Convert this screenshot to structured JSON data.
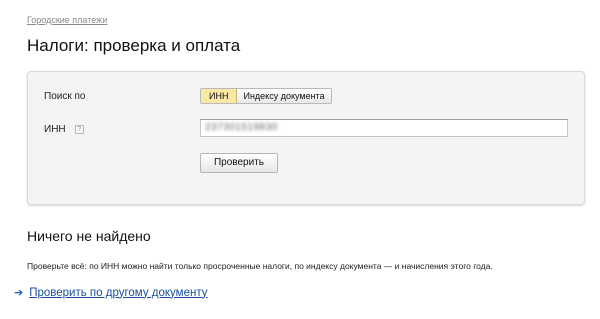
{
  "breadcrumb": "Городские платежи",
  "title": "Налоги: проверка и оплата",
  "form": {
    "search_label": "Поиск по",
    "toggle": [
      "ИНН",
      "Индексу документа"
    ],
    "active_toggle": "ИНН",
    "inn_label": "ИНН",
    "help_glyph": "?",
    "inn_value": "237301519830",
    "submit_label": "Проверить"
  },
  "result": {
    "title": "Ничего не найдено",
    "text": "Проверьте всё: по ИНН можно найти только просроченные налоги, по индексу документа — и начисления этого года."
  },
  "link": {
    "arrow": "➔",
    "label": "Проверить по другому документу"
  }
}
